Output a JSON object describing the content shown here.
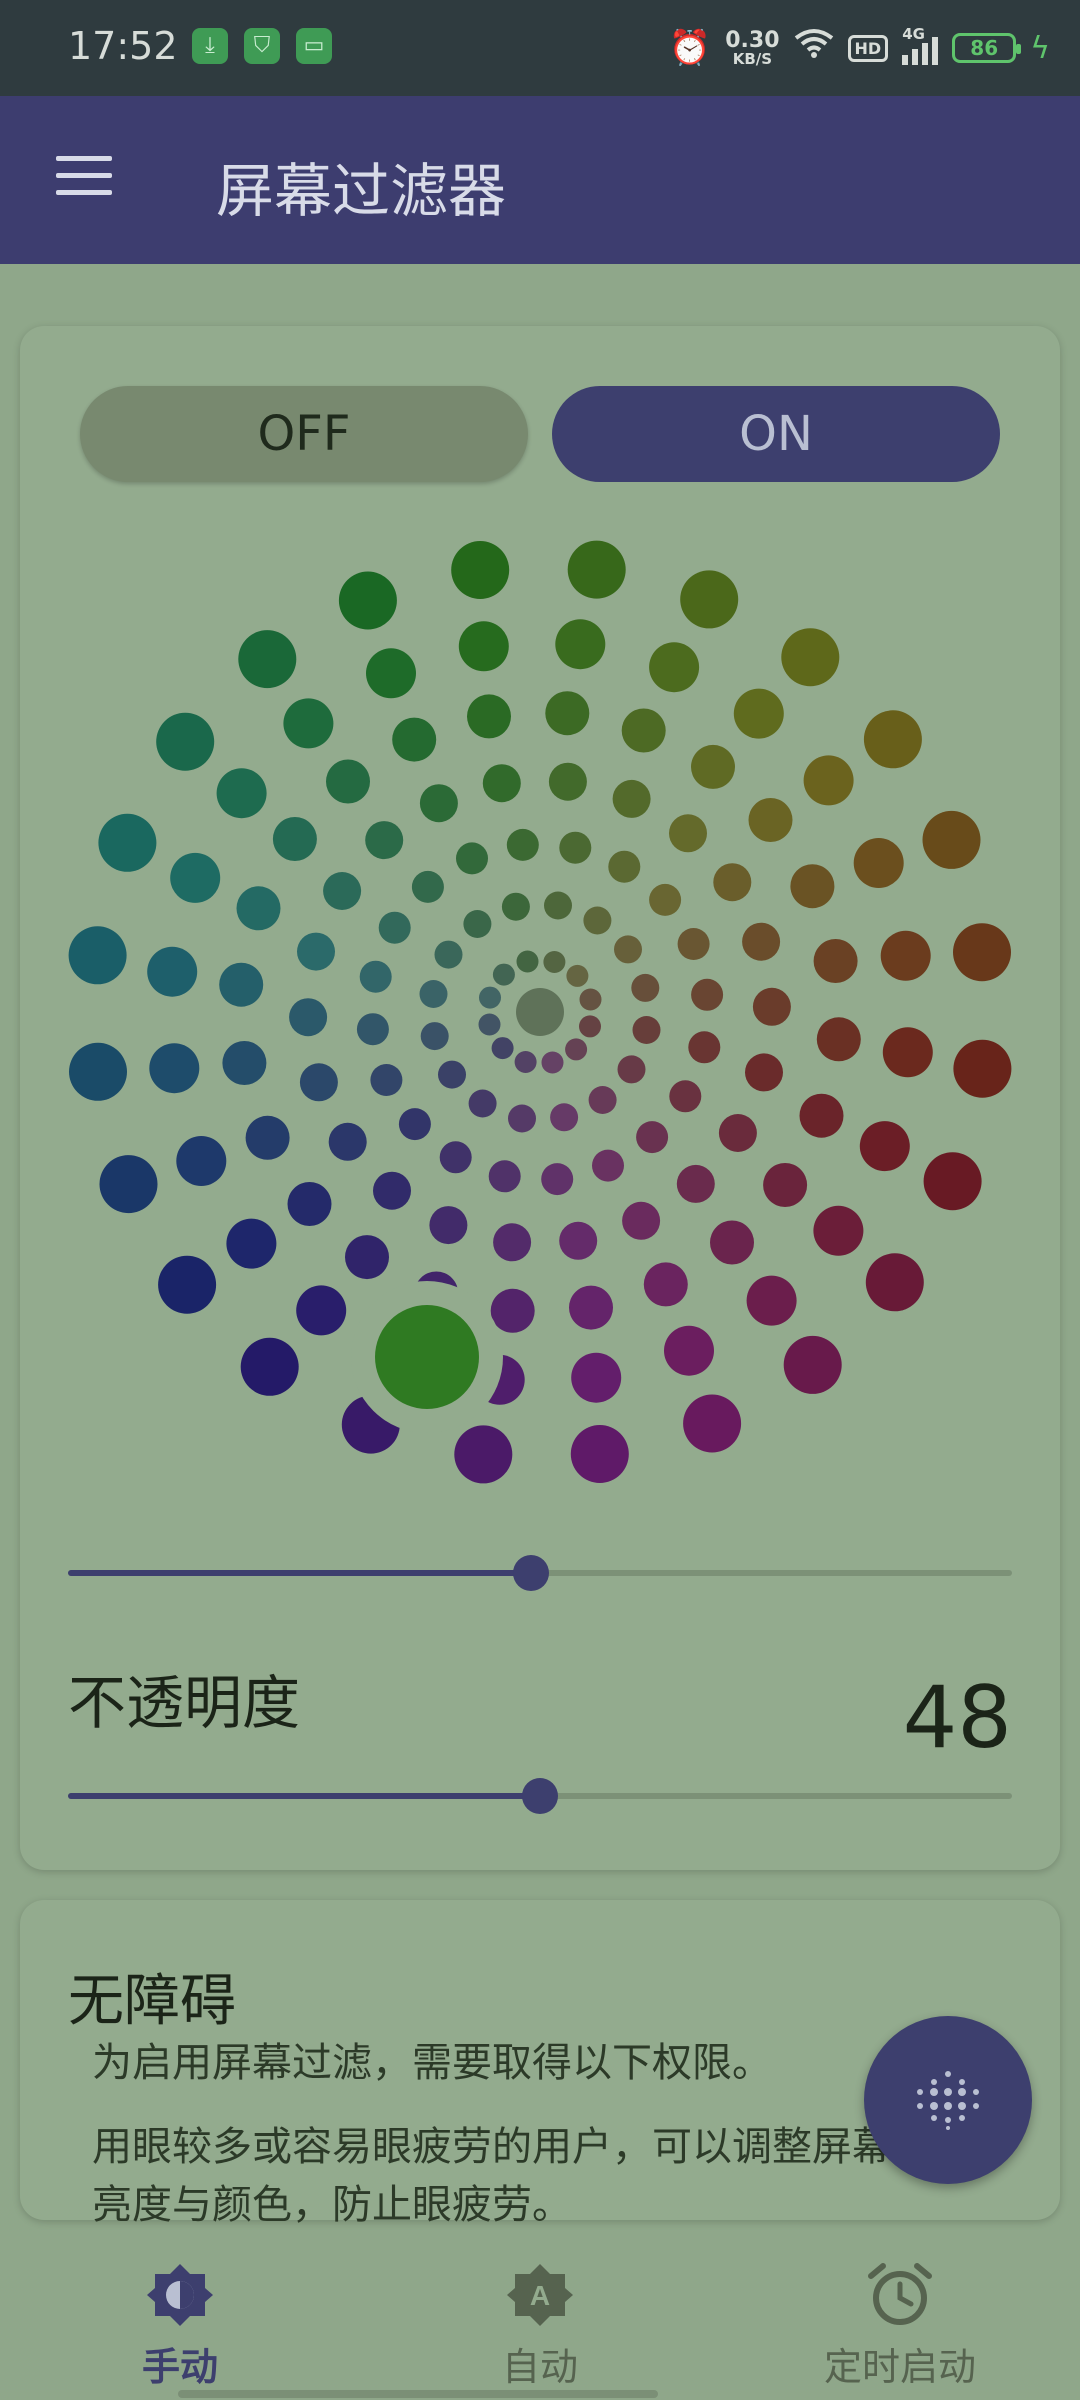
{
  "status_bar": {
    "time": "17:52",
    "net_speed_value": "0.30",
    "net_speed_unit": "KB/S",
    "hd_label": "HD",
    "network_label": "4G",
    "battery": "86",
    "icons": [
      "download-icon",
      "shield-icon",
      "message-icon",
      "alarm-icon",
      "wifi-icon",
      "signal-icon",
      "battery-icon",
      "charging-icon"
    ]
  },
  "app_bar": {
    "title": "屏幕过滤器",
    "menu_icon": "hamburger-menu-icon"
  },
  "toggle": {
    "off_label": "OFF",
    "on_label": "ON",
    "state": "ON"
  },
  "color_slider": {
    "value_fraction": 0.49
  },
  "opacity": {
    "label": "不透明度",
    "value": "48",
    "value_fraction": 0.5
  },
  "accessibility": {
    "title": "无障碍",
    "description1": "为启用屏幕过滤，需要取得以下权限。",
    "description2": "用眼较多或容易眼疲劳的用户，可以调整屏幕亮度与颜色，防止眼疲劳。"
  },
  "fab": {
    "icon": "dots-grid-icon"
  },
  "bottom_nav": {
    "items": [
      {
        "label": "手动",
        "icon": "brightness-icon",
        "active": true
      },
      {
        "label": "自动",
        "icon": "auto-brightness-icon",
        "active": false
      },
      {
        "label": "定时启动",
        "icon": "alarm-clock-icon",
        "active": false
      }
    ]
  },
  "colors": {
    "primary": "#3d3f6e",
    "background": "#8fa78a",
    "status_bar": "#2f3b3f"
  }
}
